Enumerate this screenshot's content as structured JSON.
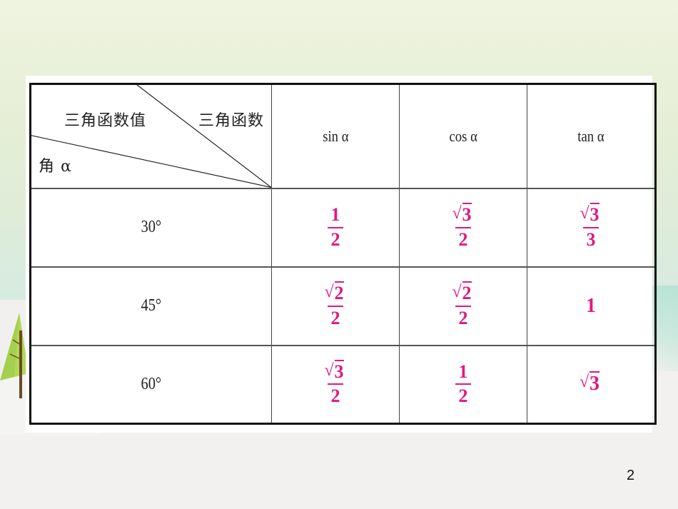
{
  "slide": {
    "page_number": "2",
    "accent_color": "#e0187f"
  },
  "table": {
    "header": {
      "diagonal_labels": {
        "values": "三角函数值",
        "functions": "三角函数",
        "angle": "角 α"
      },
      "functions": [
        "sin α",
        "cos α",
        "tan α"
      ]
    },
    "rows": [
      {
        "angle": "30°",
        "sin": {
          "type": "frac",
          "num": "1",
          "num_sqrt": false,
          "den": "2"
        },
        "cos": {
          "type": "frac",
          "num": "3",
          "num_sqrt": true,
          "den": "2"
        },
        "tan": {
          "type": "frac",
          "num": "3",
          "num_sqrt": true,
          "den": "3"
        }
      },
      {
        "angle": "45°",
        "sin": {
          "type": "frac",
          "num": "2",
          "num_sqrt": true,
          "den": "2"
        },
        "cos": {
          "type": "frac",
          "num": "2",
          "num_sqrt": true,
          "den": "2"
        },
        "tan": {
          "type": "plain",
          "value": "1"
        }
      },
      {
        "angle": "60°",
        "sin": {
          "type": "frac",
          "num": "3",
          "num_sqrt": true,
          "den": "2"
        },
        "cos": {
          "type": "frac",
          "num": "1",
          "num_sqrt": false,
          "den": "2"
        },
        "tan": {
          "type": "sqrt",
          "value": "3"
        }
      }
    ]
  }
}
